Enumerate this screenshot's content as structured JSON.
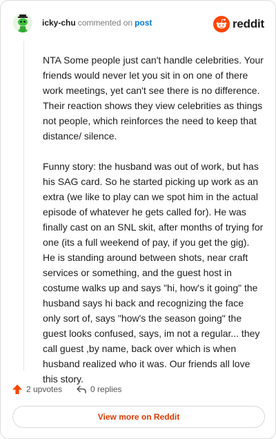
{
  "comment": {
    "username": "icky-chu",
    "action_text": "commented on",
    "post_link_label": "post",
    "paragraphs": [
      "NTA Some people just can't handle celebrities. Your friends would never let you sit in on one of there work meetings, yet can't see there is no difference. Their reaction shows they view celebrities as things not people, which reinforces the need to keep that distance/ silence.",
      "Funny story: the husband was out of work, but has his SAG card. So he started picking up work as an extra (we like to play can we spot him in the actual episode of whatever he gets called for). He was finally cast on an SNL skit, after months of trying for one (its a full weekend of pay, if you get the gig). He is standing around between shots, near craft services or something, and the guest host in costume walks up and says \"hi, how's it going\" the husband says hi back and recognizing the face only sort of, says \"how's the season going\" the guest looks confused, says, im not a regular... they call guest ,by name, back over which is when husband realized who it was. Our friends all love this story."
    ],
    "upvotes_label": "2 upvotes",
    "replies_label": "0 replies"
  },
  "brand": {
    "wordmark": "reddit",
    "icon": "reddit-snoo-icon",
    "accent_color": "#ff4500"
  },
  "cta": {
    "label": "View more on Reddit",
    "color": "#d93a00"
  },
  "icons": {
    "avatar": "snoo-avatar-green",
    "upvote": "upvote-arrow-icon",
    "reply": "reply-arrow-icon"
  }
}
